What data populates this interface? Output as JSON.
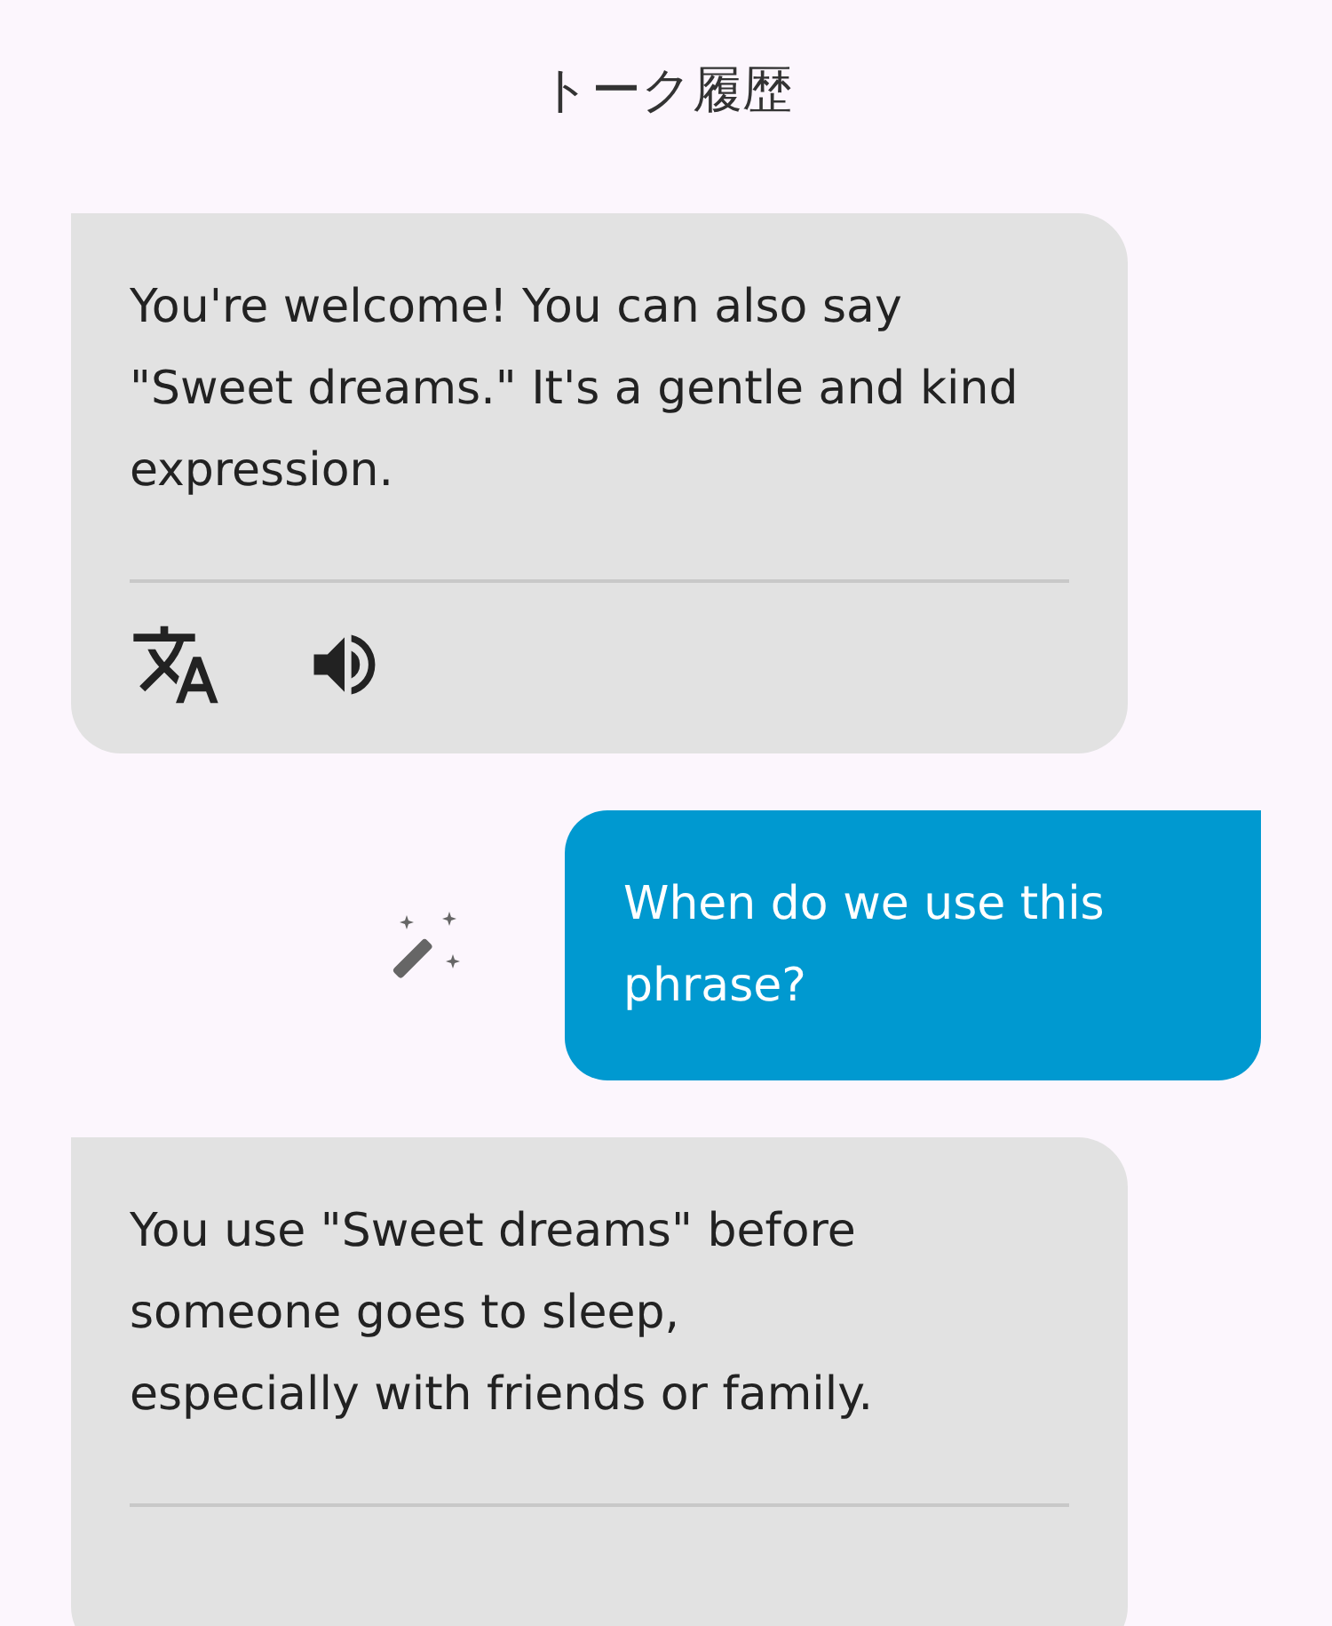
{
  "title": "トーク履歴",
  "messages": [
    {
      "kind": "bot",
      "text": "You're welcome! You can also say \"Sweet dreams.\" It's a gentle and kind expression.",
      "show_actions": true
    },
    {
      "kind": "user",
      "text": "When do we use this phrase?",
      "show_suggest": true
    },
    {
      "kind": "bot",
      "text": "You use \"Sweet dreams\" before someone goes to sleep,\nespecially with friends or family."
    }
  ]
}
